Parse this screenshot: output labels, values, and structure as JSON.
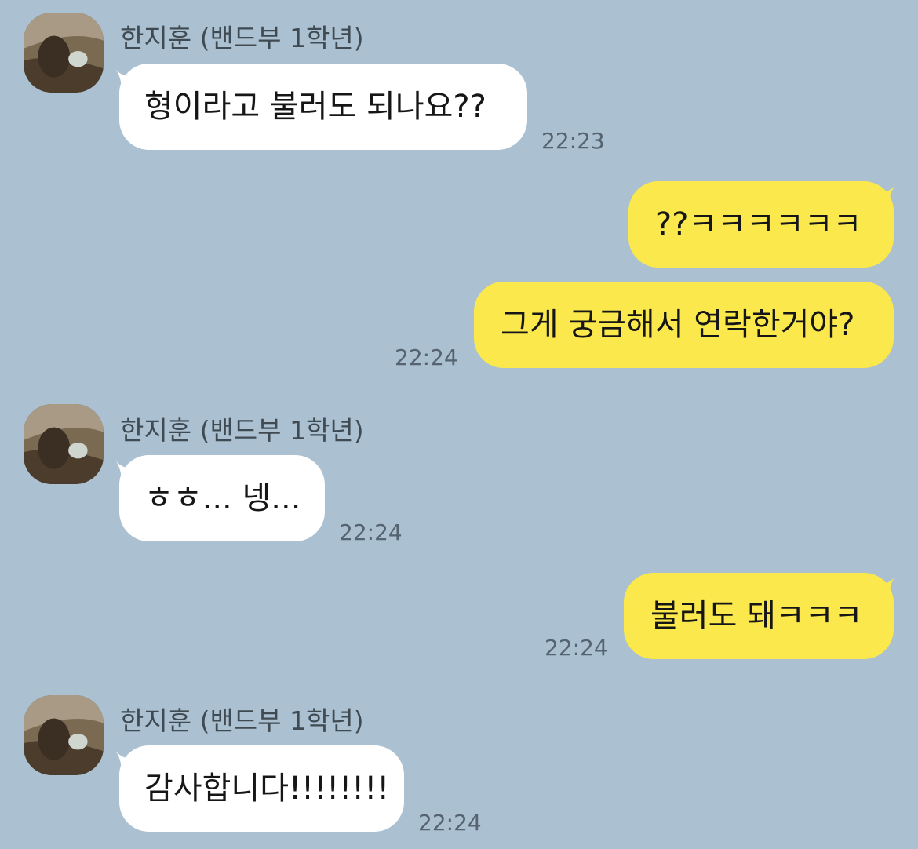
{
  "conversation": {
    "messages": [
      {
        "direction": "incoming",
        "sender": "한지훈 (밴드부 1학년)",
        "text": "형이라고 불러도 되나요??",
        "time": "22:23"
      },
      {
        "direction": "outgoing",
        "text": "??ㅋㅋㅋㅋㅋㅋ"
      },
      {
        "direction": "outgoing",
        "text": "그게 궁금해서 연락한거야?",
        "time": "22:24"
      },
      {
        "direction": "incoming",
        "sender": "한지훈 (밴드부 1학년)",
        "text": "ㅎㅎ... 넹...",
        "time": "22:24"
      },
      {
        "direction": "outgoing",
        "text": "불러도 돼ㅋㅋㅋ",
        "time": "22:24"
      },
      {
        "direction": "incoming",
        "sender": "한지훈 (밴드부 1학년)",
        "text": "감사합니다!!!!!!!!",
        "time": "22:24"
      }
    ]
  },
  "theme": {
    "background": "#abc1d1",
    "incoming_bubble": "#ffffff",
    "outgoing_bubble": "#fae84c"
  },
  "icons": {
    "avatar": "profile-photo"
  }
}
